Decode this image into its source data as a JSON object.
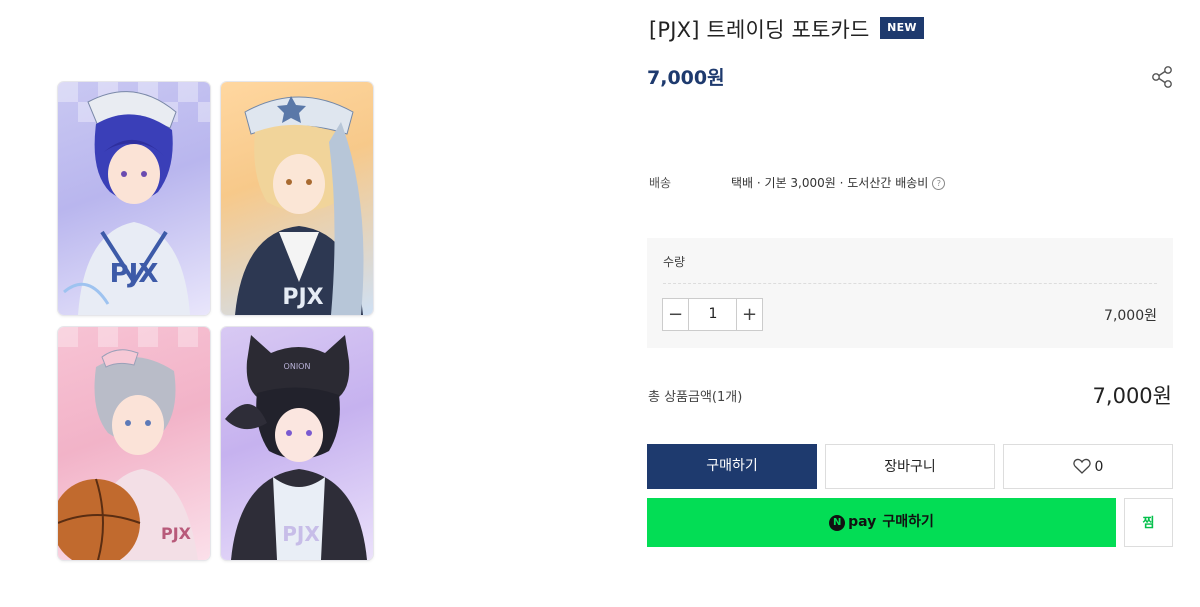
{
  "product": {
    "title": "[PJX] 트레이딩 포토카드",
    "badge": "NEW",
    "price": "7,000원"
  },
  "shipping": {
    "label": "배송",
    "value": "택배 · 기본 3,000원 · 도서산간 배송비"
  },
  "quantity": {
    "label": "수량",
    "value": "1",
    "minus_symbol": "−",
    "plus_symbol": "+",
    "line_price": "7,000원"
  },
  "total": {
    "label": "총 상품금액(1개)",
    "price": "7,000원"
  },
  "buttons": {
    "buy": "구매하기",
    "cart": "장바구니",
    "wish_count": "0",
    "npay_brand": "pay",
    "npay_label": "구매하기",
    "jjim": "찜"
  },
  "icons": {
    "share": "share-icon",
    "help": "question-circle-icon",
    "heart": "heart-outline-icon",
    "npay": "naver-pay-icon"
  },
  "colors": {
    "navy": "#1e3a6e",
    "npay_green": "#03dd55"
  }
}
